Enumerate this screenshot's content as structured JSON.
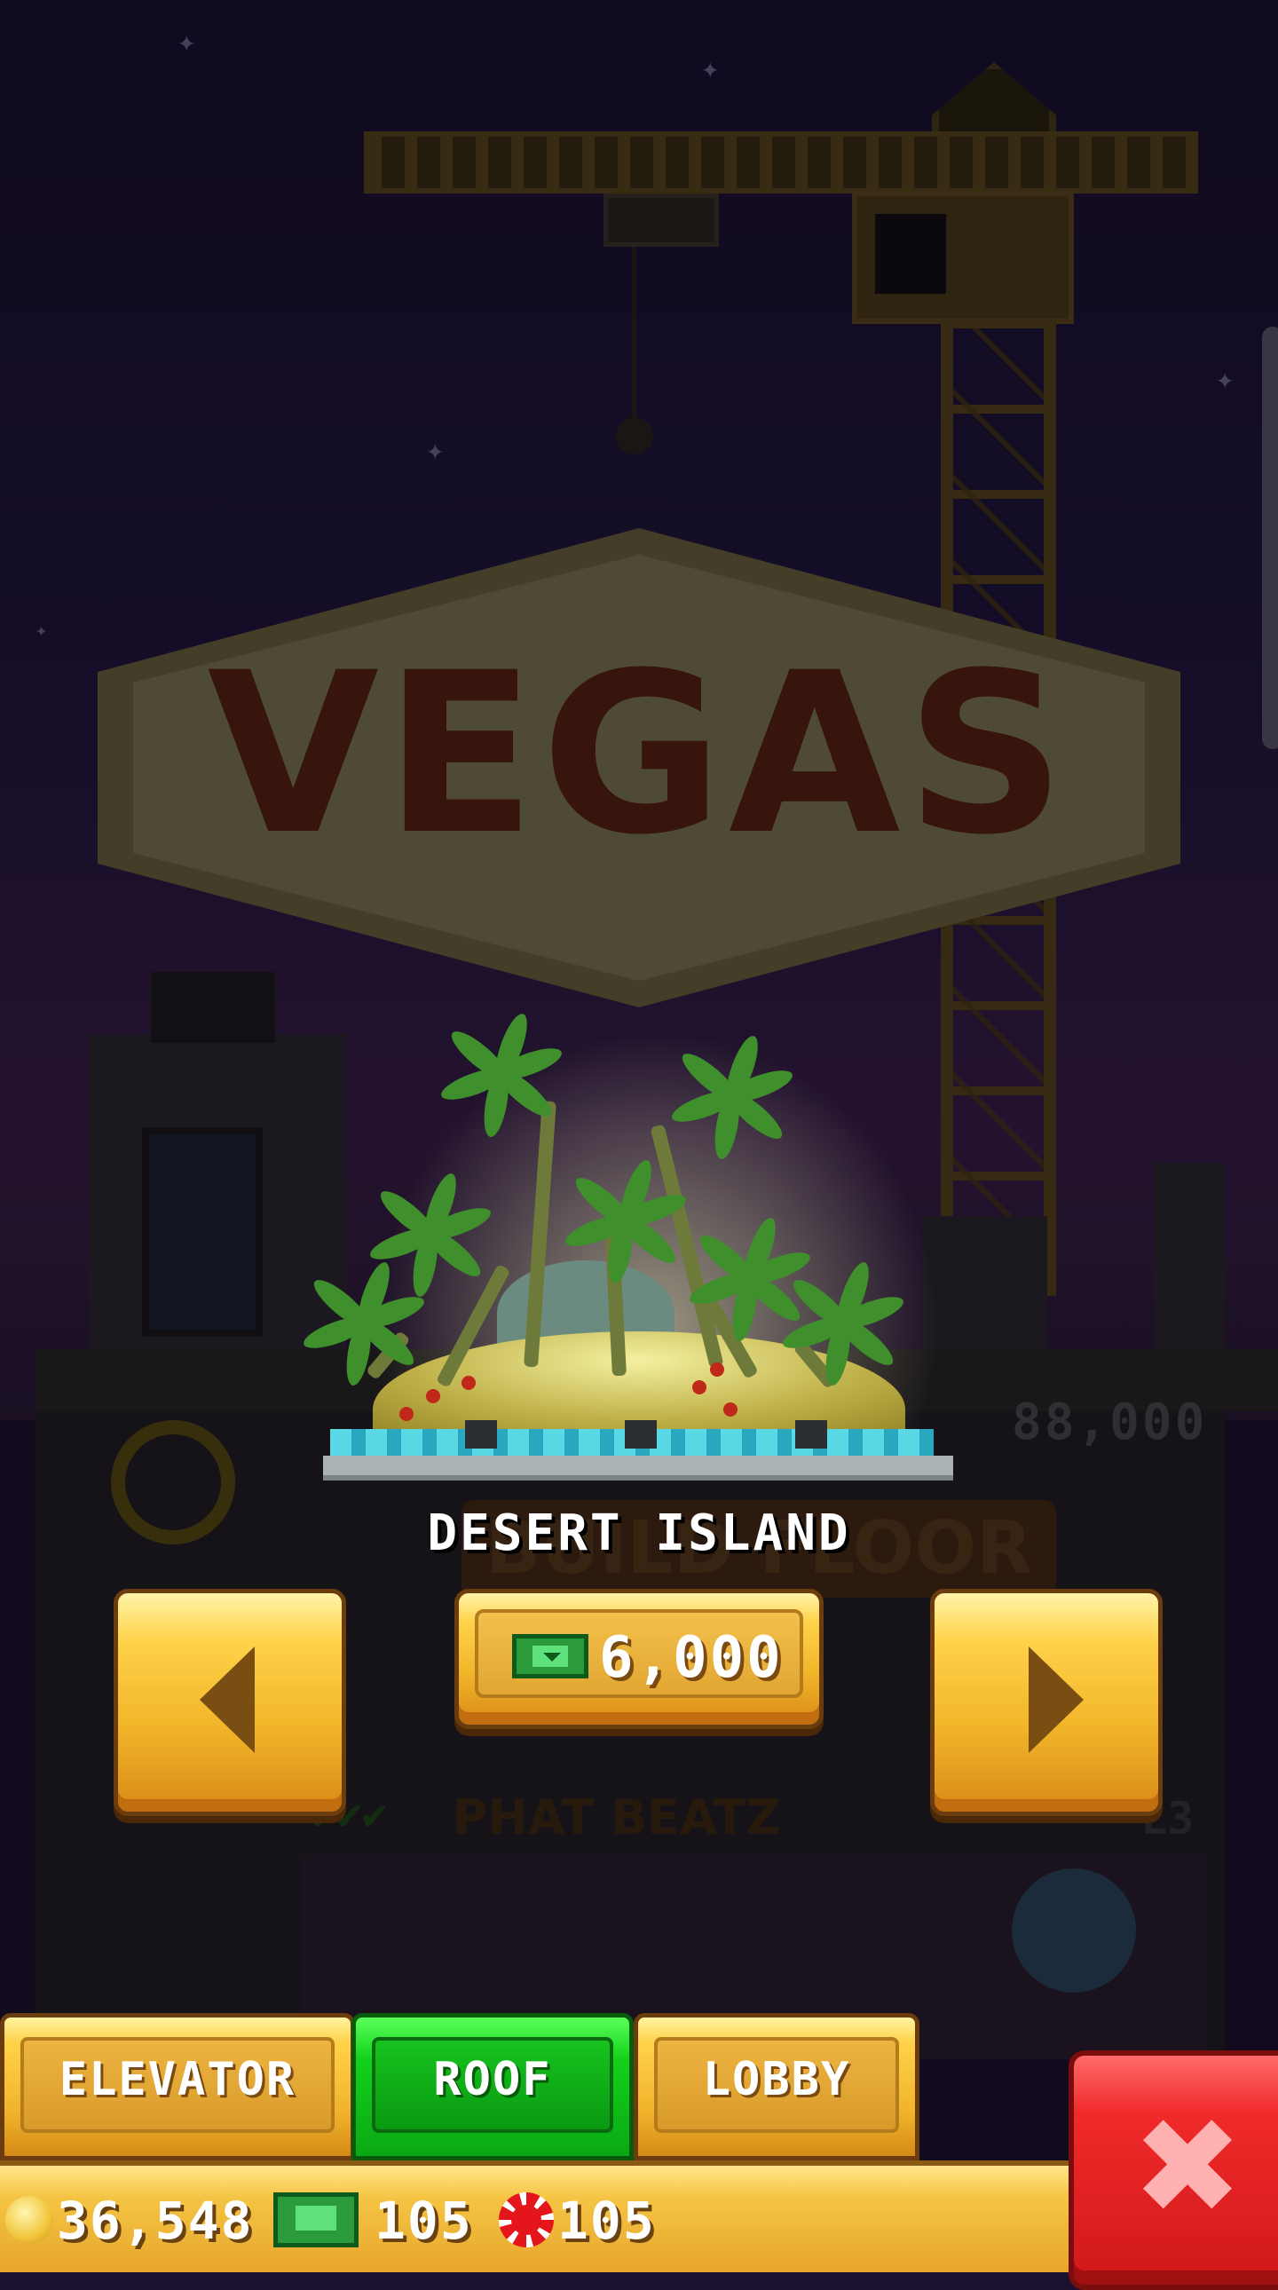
{
  "background": {
    "sign_text": "VEGAS",
    "ghost_price": "88,000",
    "ghost_button": "BUILD FLOOR",
    "ghost_floor_name": "PHAT BEATZ",
    "ghost_floor_level": "L3"
  },
  "item": {
    "name": "DESERT ISLAND",
    "price": "6,000",
    "price_currency_icon": "tower-bux-icon"
  },
  "nav": {
    "prev_icon": "arrow-left-icon",
    "next_icon": "arrow-right-icon"
  },
  "tabs": [
    {
      "label": "ELEVATOR",
      "active": false
    },
    {
      "label": "ROOF",
      "active": true
    },
    {
      "label": "LOBBY",
      "active": false
    }
  ],
  "resources": {
    "coins": "36,548",
    "bux": "105",
    "chips": "105"
  },
  "colors": {
    "active_tab": "#12d21a",
    "gold_button": "#f2b62a",
    "close_button": "#e4151b"
  }
}
